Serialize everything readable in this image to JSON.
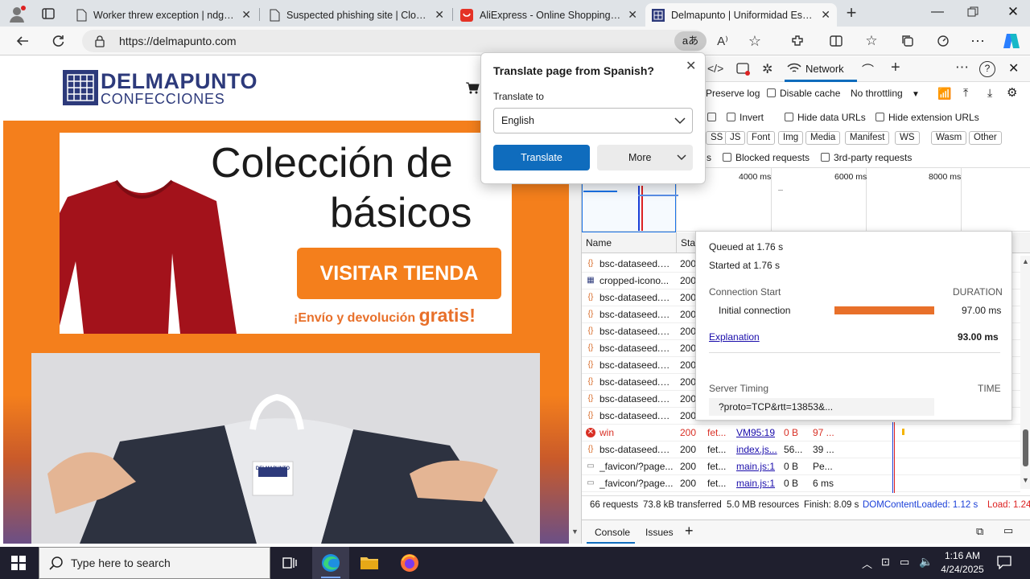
{
  "browser": {
    "tabs": [
      {
        "title": "Worker threw exception | ndgadf...",
        "active": false
      },
      {
        "title": "Suspected phishing site | Cloudfl...",
        "active": false
      },
      {
        "title": "AliExpress - Online Shopping für...",
        "active": false
      },
      {
        "title": "Delmapunto | Uniformidad Escol...",
        "active": true
      }
    ],
    "url": "https://delmapunto.com",
    "translate_badge": "aあ"
  },
  "page": {
    "logo_line1": "DELMAPUNTO",
    "logo_line2": "CONFECCIONES",
    "banner_title_1": "Colección de",
    "banner_title_2": "básicos",
    "cta": "VISITAR TIENDA",
    "shipping": "¡Envío y devolución ",
    "shipping_bold": "gratis!",
    "tag_logo": "DELMAPUNTO"
  },
  "translate_popup": {
    "title": "Translate page from Spanish?",
    "label": "Translate to",
    "language": "English",
    "translate_button": "Translate",
    "more_button": "More"
  },
  "devtools": {
    "network_tab": "Network",
    "preserve_log": "Preserve log",
    "disable_cache": "Disable cache",
    "throttling": "No throttling",
    "invert": "Invert",
    "hide_data_urls": "Hide data URLs",
    "hide_extension_urls": "Hide extension URLs",
    "filters": [
      "SS",
      "JS",
      "Font",
      "Img",
      "Media",
      "Manifest",
      "WS",
      "Wasm",
      "Other"
    ],
    "blocked_requests": "Blocked requests",
    "third_party": "3rd-party requests",
    "time_ticks": [
      "4000 ms",
      "6000 ms",
      "8000 ms"
    ],
    "col_name": "Name",
    "col_status": "Sta...",
    "rows": [
      {
        "icon": "js",
        "name": "bsc-dataseed.b...",
        "status": "200",
        "type": "",
        "initiator": "",
        "size": "",
        "time": ""
      },
      {
        "icon": "img",
        "name": "cropped-icono...",
        "status": "200",
        "type": "",
        "initiator": "",
        "size": "",
        "time": ""
      },
      {
        "icon": "js",
        "name": "bsc-dataseed.b...",
        "status": "200",
        "type": "",
        "initiator": "",
        "size": "",
        "time": ""
      },
      {
        "icon": "js",
        "name": "bsc-dataseed.b...",
        "status": "200",
        "type": "",
        "initiator": "",
        "size": "",
        "time": ""
      },
      {
        "icon": "js",
        "name": "bsc-dataseed.b...",
        "status": "200",
        "type": "",
        "initiator": "",
        "size": "",
        "time": ""
      },
      {
        "icon": "js",
        "name": "bsc-dataseed.b...",
        "status": "200",
        "type": "",
        "initiator": "",
        "size": "",
        "time": ""
      },
      {
        "icon": "js",
        "name": "bsc-dataseed.b...",
        "status": "200",
        "type": "",
        "initiator": "",
        "size": "",
        "time": ""
      },
      {
        "icon": "js",
        "name": "bsc-dataseed.b...",
        "status": "200",
        "type": "",
        "initiator": "",
        "size": "",
        "time": ""
      },
      {
        "icon": "js",
        "name": "bsc-dataseed.b...",
        "status": "200",
        "type": "",
        "initiator": "",
        "size": "",
        "time": ""
      },
      {
        "icon": "js",
        "name": "bsc-dataseed.b...",
        "status": "200",
        "type": "",
        "initiator": "",
        "size": "",
        "time": ""
      },
      {
        "icon": "err",
        "name": "win",
        "status": "200",
        "type": "fet...",
        "initiator": "VM95:19",
        "size": "0 B",
        "time": "97 ..."
      },
      {
        "icon": "js",
        "name": "bsc-dataseed.b...",
        "status": "200",
        "type": "fet...",
        "initiator": "index.js...",
        "size": "56...",
        "time": "39 ..."
      },
      {
        "icon": "doc",
        "name": "_favicon/?page...",
        "status": "200",
        "type": "fet...",
        "initiator": "main.js:1",
        "size": "0 B",
        "time": "Pe..."
      },
      {
        "icon": "doc",
        "name": "_favicon/?page...",
        "status": "200",
        "type": "fet...",
        "initiator": "main.js:1",
        "size": "0 B",
        "time": "6 ms"
      }
    ],
    "summary": {
      "requests": "66 requests",
      "transferred": "73.8 kB transferred",
      "resources": "5.0 MB resources",
      "finish": "Finish: 8.09 s",
      "dcl": "DOMContentLoaded: 1.12 s",
      "load": "Load: 1.24"
    },
    "drawer_tabs": [
      "Console",
      "Issues"
    ],
    "timing": {
      "queued": "Queued at 1.76 s",
      "started": "Started at 1.76 s",
      "conn_start": "Connection Start",
      "duration_label": "DURATION",
      "initial_connection": "Initial connection",
      "initial_connection_ms": "97.00 ms",
      "explanation": "Explanation",
      "total": "93.00 ms",
      "server_timing": "Server Timing",
      "time_label": "TIME",
      "server_entry": "?proto=TCP&rtt=13853&..."
    }
  },
  "taskbar": {
    "search_placeholder": "Type here to search",
    "time": "1:16 AM",
    "date": "4/24/2025"
  },
  "colors": {
    "accent_blue": "#0f6cbd",
    "orange": "#f47f1c",
    "logo_navy": "#2d3a7b",
    "timing_bar": "#e8702a"
  }
}
